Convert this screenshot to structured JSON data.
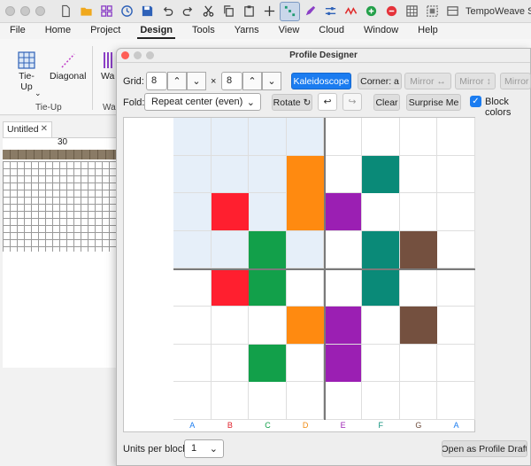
{
  "app": {
    "title": "TempoWeave Stud"
  },
  "menus": [
    "File",
    "Home",
    "Project",
    "Design",
    "Tools",
    "Yarns",
    "View",
    "Cloud",
    "Window",
    "Help"
  ],
  "active_menu": "Design",
  "ribbon": {
    "tieup_label_1": "Tie-",
    "tieup_label_2": "Up",
    "diagonal_label": "Diagonal",
    "warp_label": "Wa",
    "group_label": "Tie-Up",
    "group_label2": "Wa"
  },
  "document": {
    "tab_label": "Untitled",
    "ruler_value": "30"
  },
  "profile_designer": {
    "title": "Profile Designer",
    "grid_label": "Grid:",
    "grid_cols": "8",
    "times": "×",
    "grid_rows": "8",
    "kaleidoscope": "Kaleidoscope",
    "corner": "Corner: a",
    "mirror_h": "Mirror ↔",
    "mirror_v": "Mirror ↕",
    "mirror_more": "Mirror ↗",
    "fold_label": "Fold:",
    "fold_value": "Repeat center (even)",
    "rotate": "Rotate ↻",
    "clear": "Clear",
    "surprise": "Surprise Me",
    "block_colors": "Block colors",
    "units_label": "Units per block:",
    "units_value": "1",
    "open_button": "Open as Profile Draft",
    "column_letters": [
      "A",
      "B",
      "C",
      "D",
      "E",
      "F",
      "G",
      "A"
    ],
    "letter_colors": [
      "#1b7cf0",
      "#e0202a",
      "#12a04a",
      "#f08a10",
      "#9b1fb3",
      "#0a8f7a",
      "#6d4c3d",
      "#1b7cf0"
    ],
    "block_color_map": {
      "B": "#ff1f2f",
      "C": "#12a04a",
      "D": "#ff8a10",
      "E": "#9b1fb3",
      "F": "#0a8a78",
      "G": "#74503f"
    },
    "cells": [
      "........",
      "...D.F..",
      ".B.DE...",
      "..C..FG.",
      ".BC..F..",
      "...DE.G.",
      "..C.E...",
      "........"
    ]
  }
}
